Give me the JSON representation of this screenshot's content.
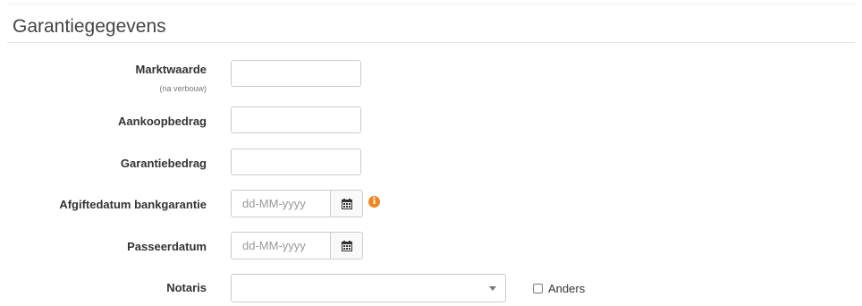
{
  "section": {
    "title": "Garantiegegevens"
  },
  "fields": {
    "marktwaarde": {
      "label": "Marktwaarde",
      "sublabel": "(na verbouw)",
      "value": ""
    },
    "aankoopbedrag": {
      "label": "Aankoopbedrag",
      "value": ""
    },
    "garantiebedrag": {
      "label": "Garantiebedrag",
      "value": ""
    },
    "afgiftedatum": {
      "label": "Afgiftedatum bankgarantie",
      "placeholder": "dd-MM-yyyy",
      "calendar_icon": "calendar-icon",
      "info_icon": "info-icon"
    },
    "passeerdatum": {
      "label": "Passeerdatum",
      "placeholder": "dd-MM-yyyy",
      "calendar_icon": "calendar-icon"
    },
    "notaris": {
      "label": "Notaris",
      "selected": "",
      "caret_icon": "caret-down-icon"
    },
    "anders": {
      "label": "Anders",
      "checked": false
    }
  },
  "colors": {
    "info_icon": "#f0861e",
    "border": "#cccccc",
    "label": "#333333"
  }
}
